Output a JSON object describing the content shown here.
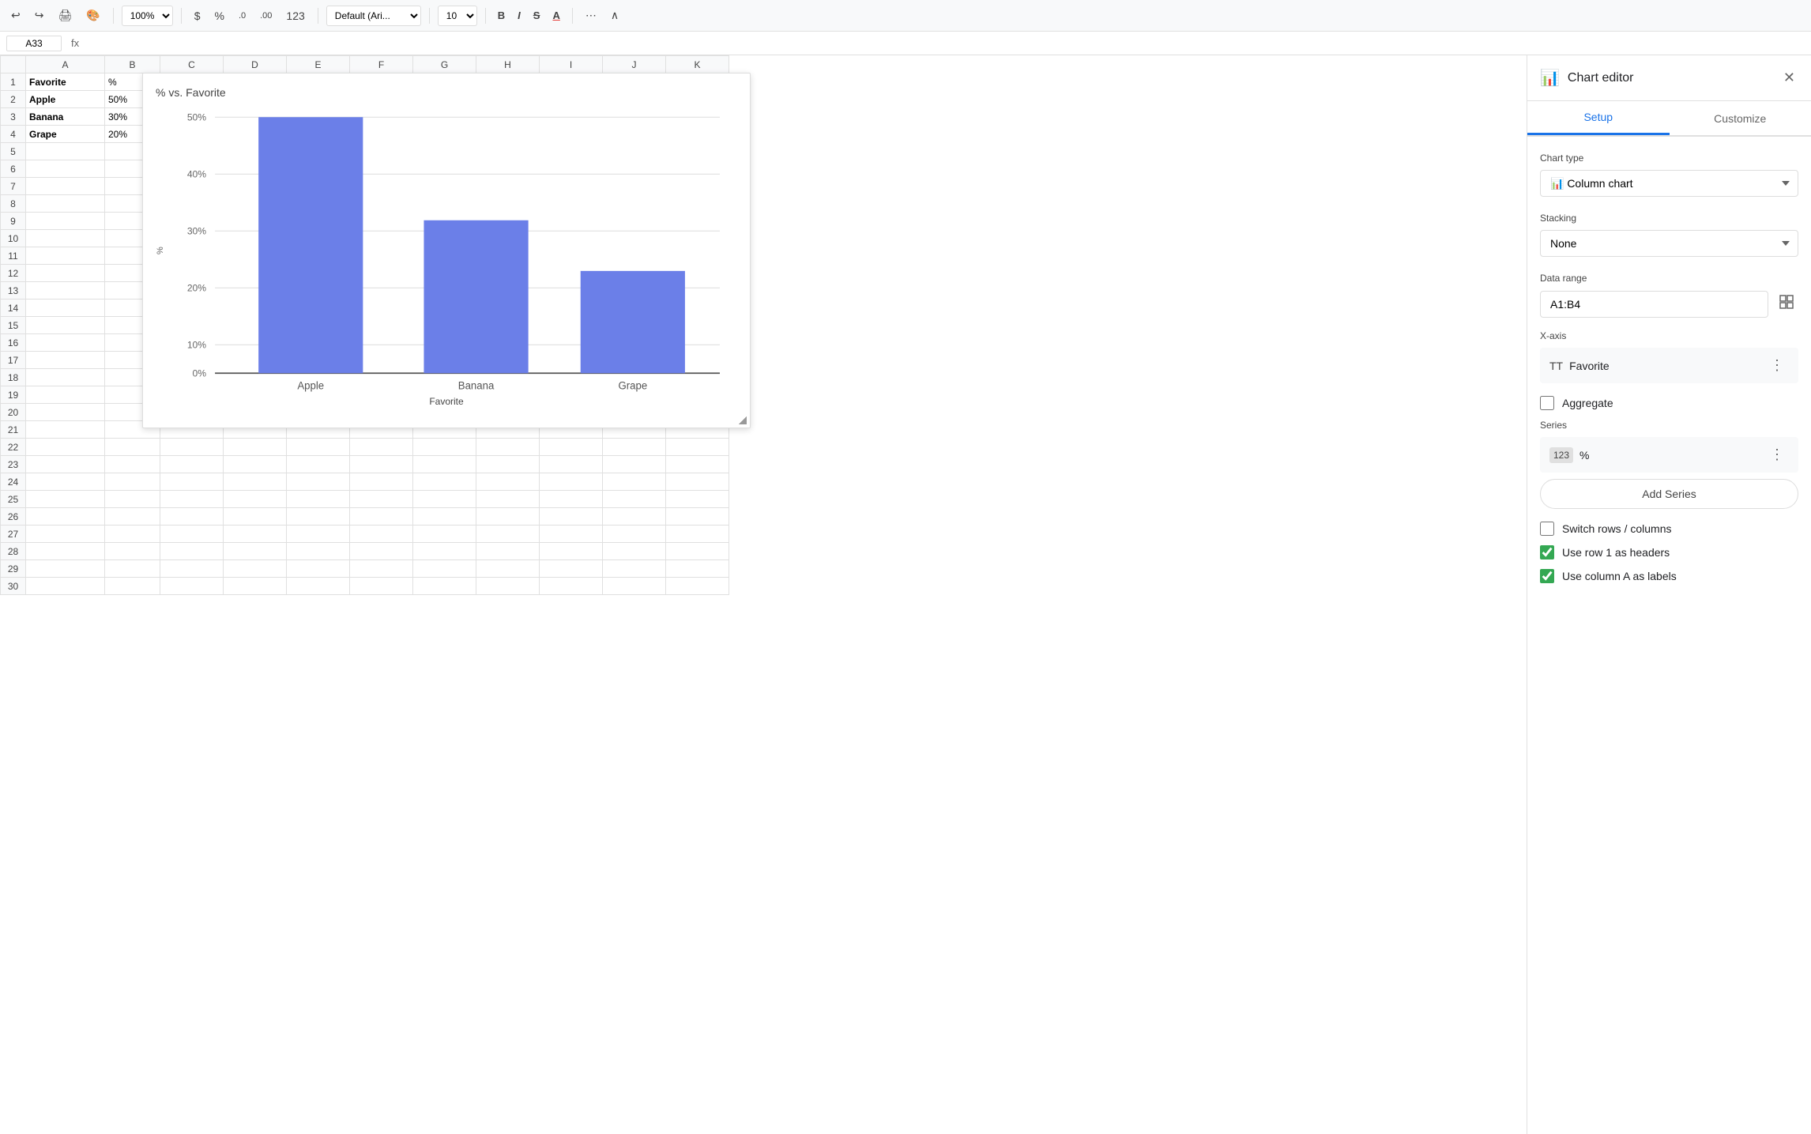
{
  "toolbar": {
    "undo_label": "↩",
    "redo_label": "↪",
    "print_label": "🖨",
    "paint_format_label": "🎨",
    "zoom": "100%",
    "currency": "$",
    "percent": "%",
    "decimal_decrease": ".0",
    "decimal_increase": ".00",
    "number_format": "123",
    "font_family": "Default (Ari...",
    "font_size": "10",
    "bold": "B",
    "italic": "I",
    "strikethrough": "S",
    "text_color": "A",
    "more": "⋯",
    "collapse": "∧"
  },
  "formula_bar": {
    "cell_ref": "A33",
    "fx_label": "fx"
  },
  "spreadsheet": {
    "columns": [
      "",
      "A",
      "B",
      "C",
      "D",
      "E",
      "F",
      "G",
      "H",
      "I",
      "J",
      "K"
    ],
    "rows": [
      {
        "row": 1,
        "a": "Favorite",
        "b": "%"
      },
      {
        "row": 2,
        "a": "Apple",
        "b": "50%"
      },
      {
        "row": 3,
        "a": "Banana",
        "b": "30%"
      },
      {
        "row": 4,
        "a": "Grape",
        "b": "20%"
      },
      {
        "row": 5
      },
      {
        "row": 6
      },
      {
        "row": 7
      },
      {
        "row": 8
      },
      {
        "row": 9
      },
      {
        "row": 10
      },
      {
        "row": 11
      },
      {
        "row": 12
      },
      {
        "row": 13
      },
      {
        "row": 14
      },
      {
        "row": 15
      },
      {
        "row": 16
      },
      {
        "row": 17
      },
      {
        "row": 18
      },
      {
        "row": 19
      },
      {
        "row": 20
      },
      {
        "row": 21
      },
      {
        "row": 22
      },
      {
        "row": 23
      },
      {
        "row": 24
      },
      {
        "row": 25
      },
      {
        "row": 26
      },
      {
        "row": 27
      },
      {
        "row": 28
      },
      {
        "row": 29
      },
      {
        "row": 30
      }
    ]
  },
  "chart": {
    "title": "% vs. Favorite",
    "x_axis_label": "Favorite",
    "y_axis_label": "%",
    "bars": [
      {
        "label": "Apple",
        "value": 50
      },
      {
        "label": "Banana",
        "value": 30
      },
      {
        "label": "Grape",
        "value": 20
      }
    ],
    "y_ticks": [
      "50%",
      "40%",
      "30%",
      "20%",
      "10%",
      "0%"
    ],
    "bar_color": "#6b7fe8"
  },
  "chart_editor": {
    "title": "Chart editor",
    "close_label": "✕",
    "tabs": [
      {
        "label": "Setup",
        "active": true
      },
      {
        "label": "Customize",
        "active": false
      }
    ],
    "setup": {
      "chart_type_label": "Chart type",
      "chart_type_value": "Column chart",
      "chart_type_icon": "📊",
      "stacking_label": "Stacking",
      "stacking_value": "None",
      "data_range_label": "Data range",
      "data_range_value": "A1:B4",
      "x_axis_label": "X-axis",
      "x_axis_value": "Favorite",
      "aggregate_label": "Aggregate",
      "aggregate_checked": false,
      "series_label": "Series",
      "series_value": "%",
      "add_series_label": "Add Series",
      "switch_rows_label": "Switch rows / columns",
      "switch_rows_checked": false,
      "use_row_header_label": "Use row 1 as headers",
      "use_row_header_checked": true,
      "use_column_a_label": "Use column A as labels",
      "use_column_a_checked": true
    }
  }
}
